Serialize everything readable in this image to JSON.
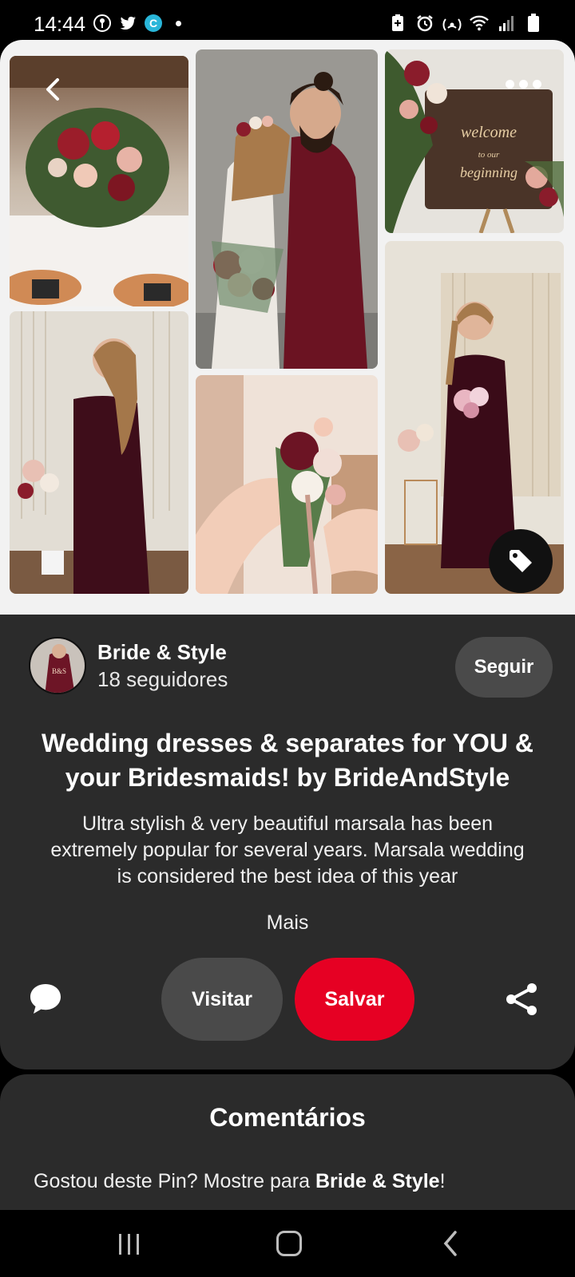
{
  "status": {
    "time": "14:44",
    "left_icons": [
      "vpn-key-icon",
      "twitter-icon",
      "app-c-icon",
      "notification-dot"
    ],
    "right_icons": [
      "battery-saver-icon",
      "alarm-icon",
      "hotspot-icon",
      "wifi-icon",
      "signal-icon",
      "battery-icon"
    ]
  },
  "collage": {
    "tiles": [
      "table-centerpiece",
      "couple-embrace",
      "welcome-sign",
      "bridesmaid-back",
      "bouquet-hands",
      "bridesmaid-front"
    ],
    "sign_text": "welcome to our beginning"
  },
  "creator": {
    "name": "Bride & Style",
    "followers": "18 seguidores",
    "follow_label": "Seguir"
  },
  "pin": {
    "title": "Wedding dresses & separates for YOU & your Bridesmaids! by BrideAndStyle",
    "description": "Ultra stylish & very beautiful marsala has been extremely popular for several years. Marsala wedding is considered the best idea of this year",
    "more_label": "Mais"
  },
  "actions": {
    "visit_label": "Visitar",
    "save_label": "Salvar"
  },
  "comments": {
    "title": "Comentários",
    "prompt_prefix": "Gostou deste Pin? Mostre para ",
    "prompt_name": "Bride & Style",
    "prompt_suffix": "!"
  },
  "colors": {
    "save_red": "#e60023",
    "panel_bg": "#2b2b2b",
    "button_gray": "#4a4a4a",
    "marsala": "#5a1424"
  }
}
